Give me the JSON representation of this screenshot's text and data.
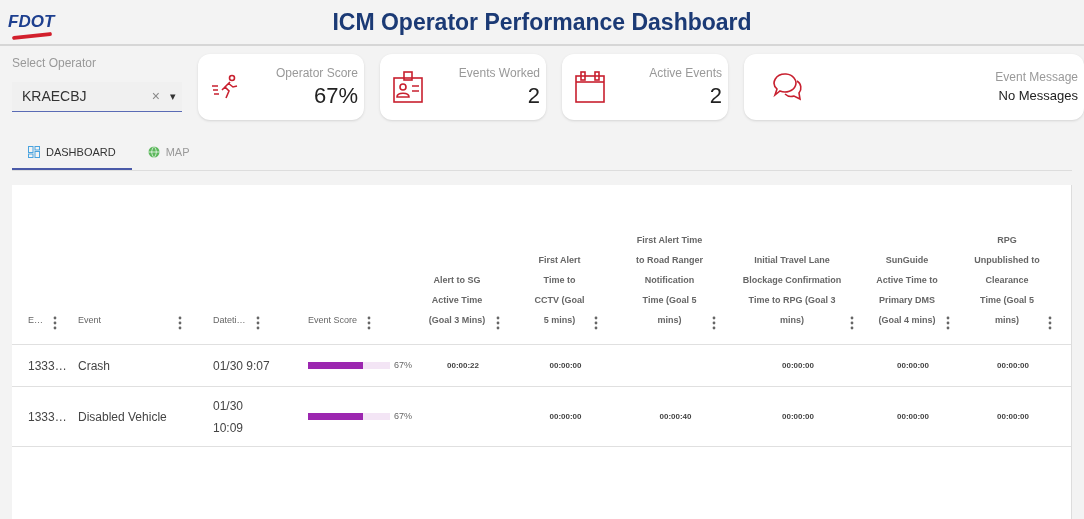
{
  "header": {
    "logo": "FDOT",
    "title": "ICM Operator Performance Dashboard"
  },
  "operator_select": {
    "label": "Select Operator",
    "value": "KRAECBJ",
    "clear": "×",
    "caret": "▾"
  },
  "cards": [
    {
      "kind": "runner",
      "label": "Operator Score",
      "value": "67%"
    },
    {
      "kind": "badge",
      "label": "Events Worked",
      "value": "2"
    },
    {
      "kind": "calendar",
      "label": "Active Events",
      "value": "2"
    },
    {
      "kind": "chat",
      "label": "Event Message",
      "value": "No Messages"
    }
  ],
  "tabs": [
    {
      "label": "DASHBOARD",
      "kind": "dashboard",
      "selected": true
    },
    {
      "label": "MAP",
      "kind": "globe",
      "selected": false
    }
  ],
  "table": {
    "columns": [
      "E…",
      "Event",
      "Dateti…",
      "Event Score",
      "Alert to SG Active Time (Goal 3 Mins)",
      "First Alert Time to CCTV (Goal 5 mins)",
      "First Alert Time to Road Ranger Notification Time (Goal 5 mins)",
      "Initial Travel Lane Blockage Confirmation Time to RPG (Goal 3 mins)",
      "SunGuide Active Time to Primary DMS (Goal 4 mins)",
      "RPG Unpublished to Clearance Time (Goal 5 mins)"
    ],
    "rows": [
      {
        "id": "1333…",
        "event": "Crash",
        "datetime": "01/30 9:07",
        "score": {
          "level": 0.67,
          "label": "67%"
        },
        "times": {
          "alert_to_sg": "00:00:22",
          "alert_to_cctv": "00:00:00",
          "lane_blockage_to_rpg": "00:00:00",
          "sunguide_to_dms": "00:00:00",
          "rpg_to_clearance": "00:00:00"
        }
      },
      {
        "id": "1333…",
        "event": "Disabled Vehicle",
        "datetime": "01/30 10:09",
        "score": {
          "level": 0.67,
          "label": "67%"
        },
        "times": {
          "alert_to_cctv": "00:00:00",
          "alert_to_road_ranger": "00:00:40",
          "lane_blockage_to_rpg": "00:00:00",
          "sunguide_to_dms": "00:00:00",
          "rpg_to_clearance": "00:00:00"
        }
      }
    ]
  }
}
